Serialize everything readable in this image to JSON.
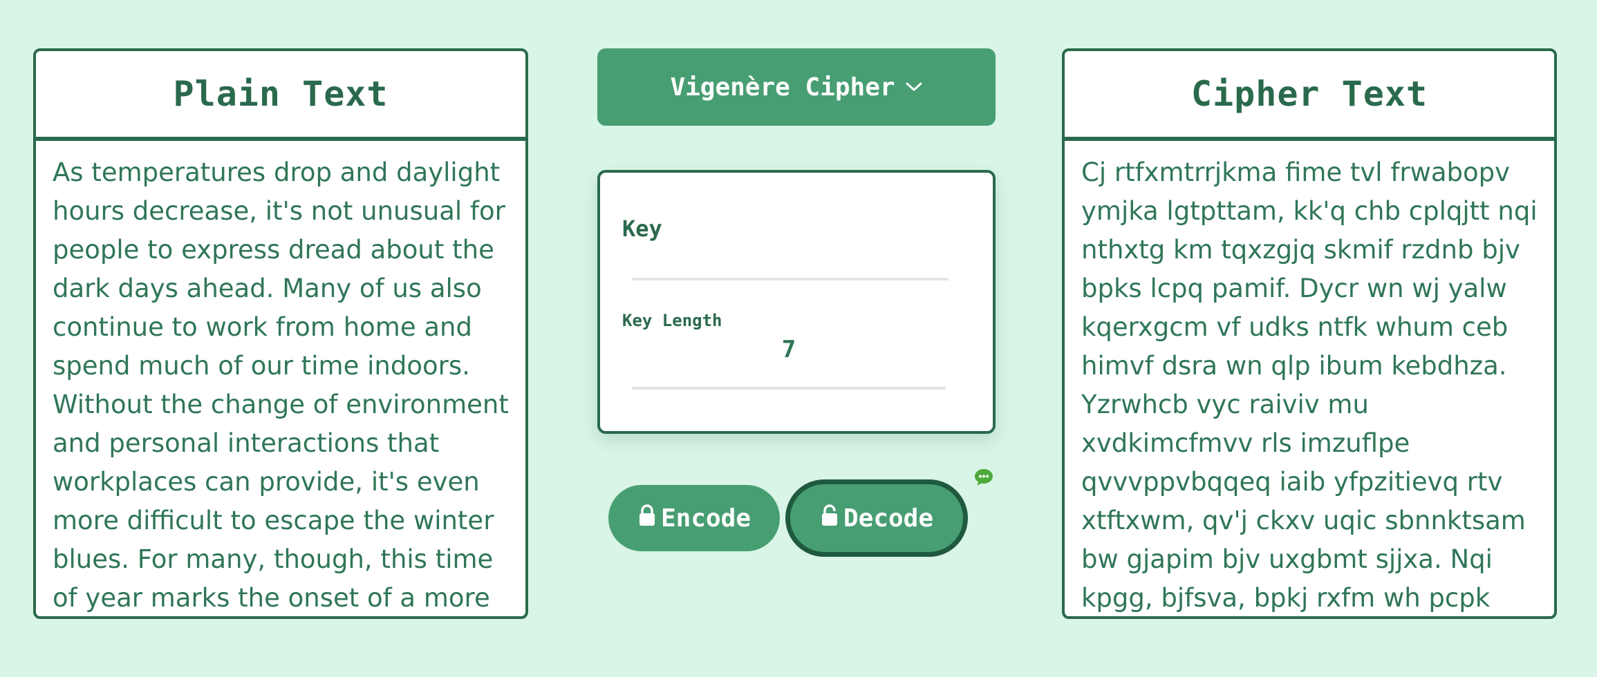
{
  "plain_panel": {
    "title": "Plain Text",
    "text": "As temperatures drop and daylight hours decrease, it's not unusual for people to express dread about the dark days ahead. Many of us also continue to work from home and spend much of our time indoors. Without the change of environment and personal interactions that workplaces can provide, it's even more difficult to escape the winter blues. For many, though, this time of year marks the onset of a more"
  },
  "cipher_selector": {
    "label": "Vigenère Cipher",
    "icon": "chevron-down-icon"
  },
  "key_card": {
    "key_label": "Key",
    "key_value": "",
    "key_length_label": "Key Length",
    "key_length_value": "7"
  },
  "actions": {
    "encode_label": "Encode",
    "encode_icon": "lock-icon",
    "decode_label": "Decode",
    "decode_icon": "unlock-icon",
    "help_icon": "chat-icon"
  },
  "cipher_panel": {
    "title": "Cipher Text",
    "text": "Cj rtfxmtrrjkma fime tvl frwabopv ymjka lgtpttam, kk'q chb cplqjtt nqi nthxtg km tqxzgjq skmif rzdnb bjv bpks lcpq pamif. Dycr wn wj yalw kqerxgcm vf udks ntfk whum ceb himvf dsra wn qlp ibum kebdhza. Yzrwhcb vyc raiviv mu xvdkimcfmvv rls imzuflpe qvvvppvbqqeq iaib yfpzitievq rtv xtftxwm, qv'j ckxv uqic sbnnktsam bw gjapim bjv uxgbmt sjjxa. Nqi kpgg, bjfsva, bpkj rxfm wh pcpk uitbq iam wpjci hn i ofpt"
  },
  "colors": {
    "background": "#d9f5e7",
    "accent": "#489e73",
    "border": "#2a6a4c",
    "text": "#2f7657"
  }
}
